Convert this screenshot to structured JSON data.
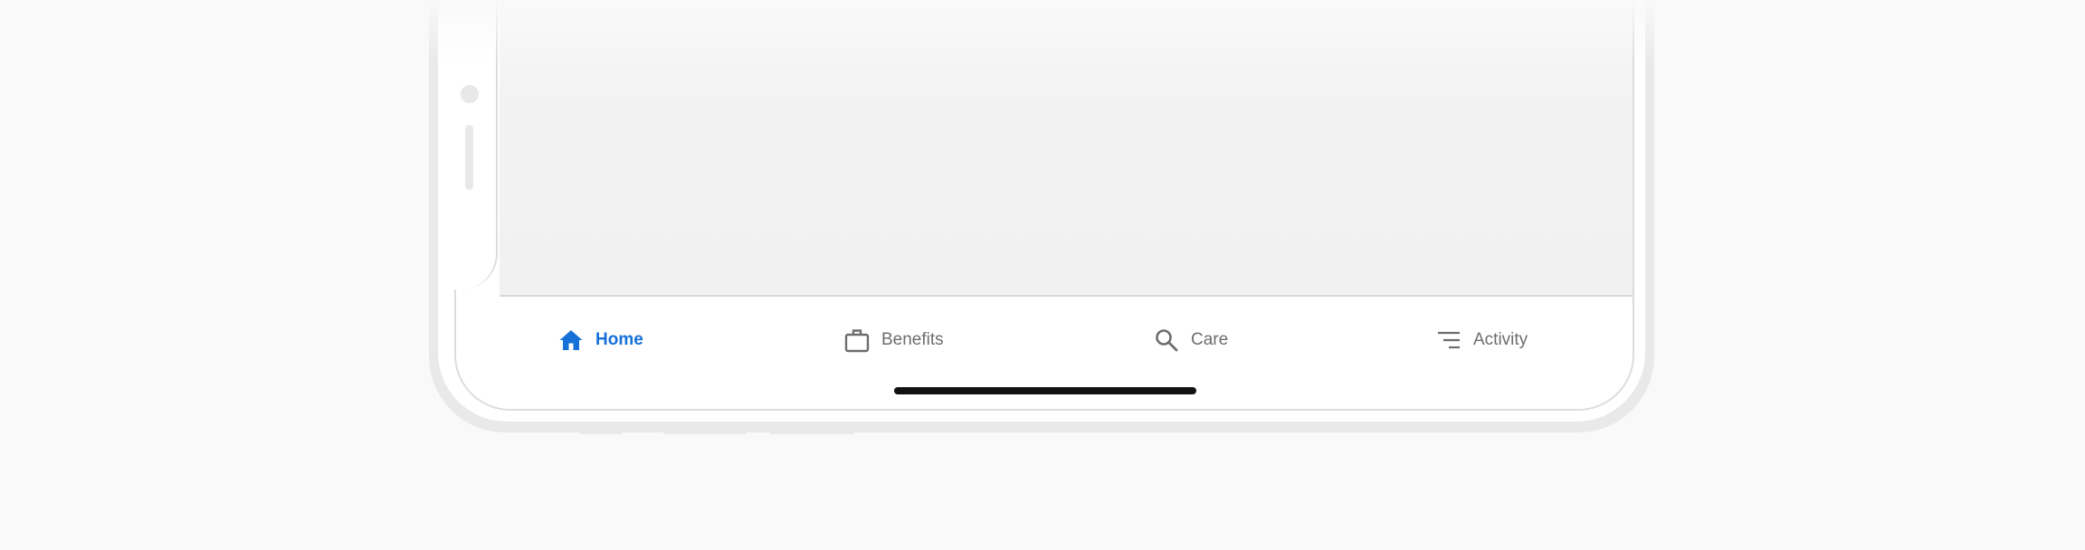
{
  "tab_bar": {
    "tabs": [
      {
        "label": "Home",
        "icon": "home-icon",
        "active": true
      },
      {
        "label": "Benefits",
        "icon": "briefcase-icon",
        "active": false
      },
      {
        "label": "Care",
        "icon": "search-icon",
        "active": false
      },
      {
        "label": "Activity",
        "icon": "activity-list-icon",
        "active": false
      }
    ]
  },
  "colors": {
    "accent": "#1570d8",
    "inactive": "#6d6d6d",
    "background": "#f9f9f9",
    "home_indicator": "#111111"
  }
}
